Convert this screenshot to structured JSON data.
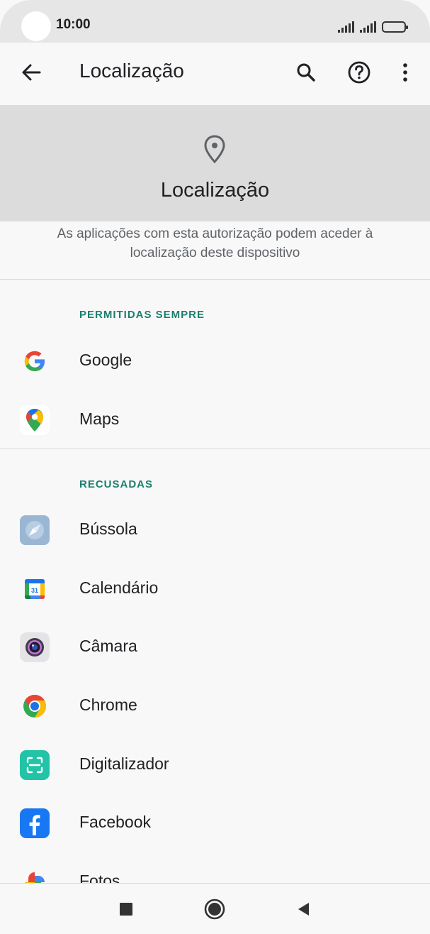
{
  "status_bar": {
    "time": "10:00"
  },
  "app_bar": {
    "title": "Localização"
  },
  "header": {
    "title": "Localização"
  },
  "description": "As aplicações com esta autorização podem aceder à localização deste dispositivo",
  "sections": {
    "allowed": {
      "label": "PERMITIDAS SEMPRE",
      "apps": [
        {
          "name": "Google",
          "icon": "google-icon"
        },
        {
          "name": "Maps",
          "icon": "maps-icon"
        }
      ]
    },
    "denied": {
      "label": "RECUSADAS",
      "apps": [
        {
          "name": "Bússola",
          "icon": "compass-icon"
        },
        {
          "name": "Calendário",
          "icon": "calendar-icon",
          "badge": "31"
        },
        {
          "name": "Câmara",
          "icon": "camera-icon"
        },
        {
          "name": "Chrome",
          "icon": "chrome-icon"
        },
        {
          "name": "Digitalizador",
          "icon": "scanner-icon"
        },
        {
          "name": "Facebook",
          "icon": "facebook-icon"
        },
        {
          "name": "Fotos",
          "icon": "photos-icon"
        }
      ]
    }
  },
  "colors": {
    "accent": "#1a7f6e",
    "header_bg": "#dcdcdc",
    "page_bg": "#f8f8f8"
  }
}
